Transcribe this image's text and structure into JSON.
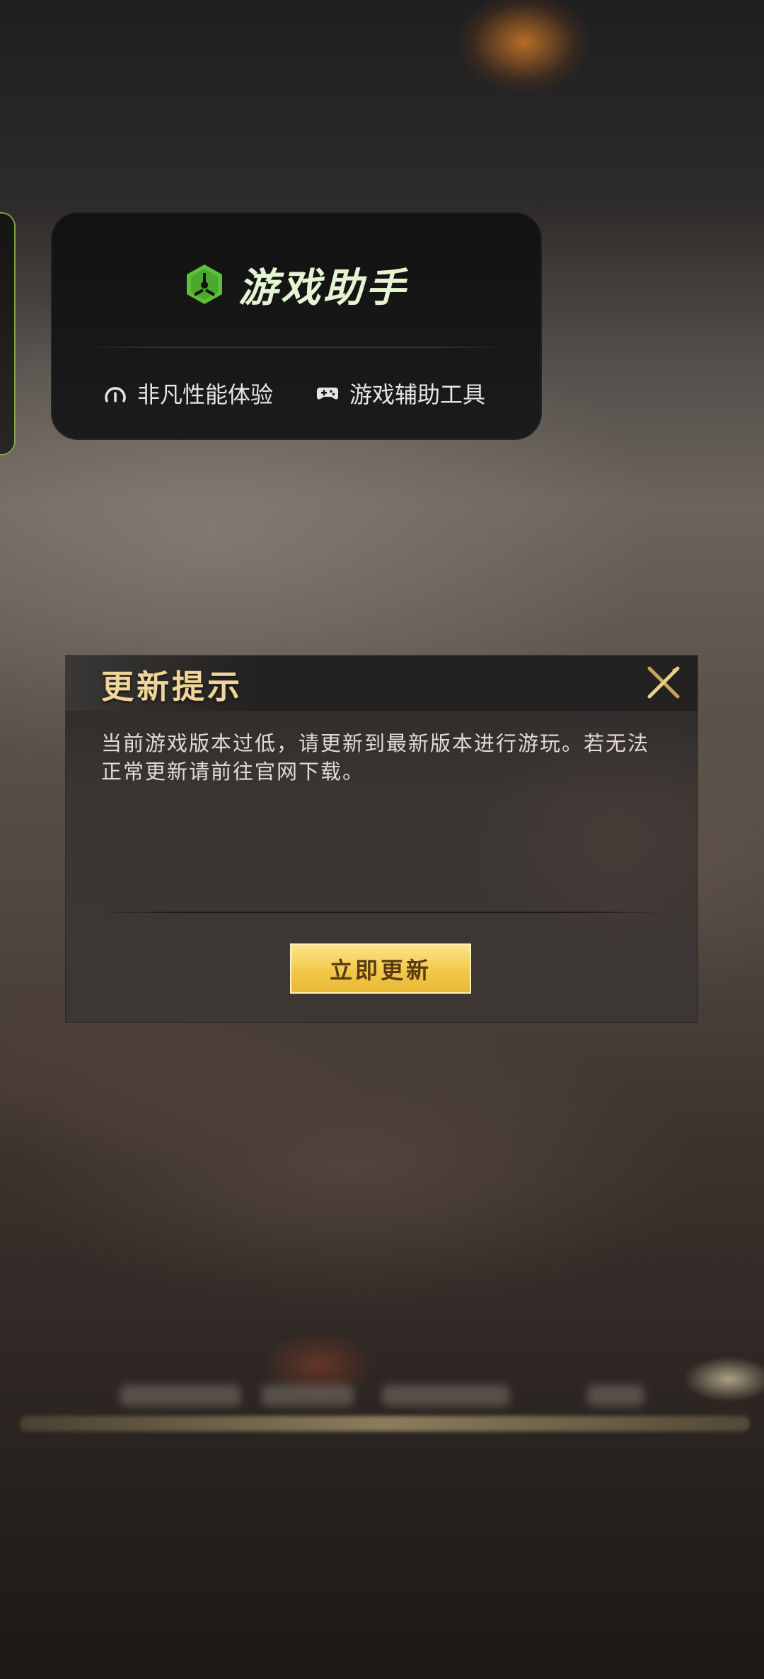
{
  "assistant": {
    "title": "游戏助手",
    "features": [
      {
        "label": "非凡性能体验",
        "icon": "speedometer-icon"
      },
      {
        "label": "游戏辅助工具",
        "icon": "gamepad-icon"
      }
    ],
    "accent_color": "#5fbf3a"
  },
  "dialog": {
    "title": "更新提示",
    "message": "当前游戏版本过低，请更新到最新版本进行游玩。若无法正常更新请前往官网下载。",
    "button_label": "立即更新",
    "close_icon": "close-icon"
  }
}
